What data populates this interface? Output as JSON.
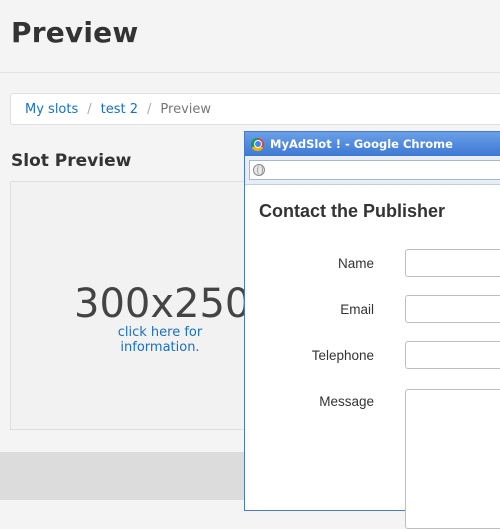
{
  "header": {
    "title": "Preview"
  },
  "breadcrumb": {
    "items": [
      "My slots",
      "test 2"
    ],
    "current": "Preview",
    "separator": "/"
  },
  "slot_preview": {
    "title": "Slot Preview",
    "size": "300x250",
    "info_link": "click here for information."
  },
  "popup": {
    "window_title": "MyAdSlot ! - Google Chrome",
    "heading": "Contact the Publisher",
    "fields": {
      "name_label": "Name",
      "email_label": "Email",
      "telephone_label": "Telephone",
      "message_label": "Message"
    }
  }
}
